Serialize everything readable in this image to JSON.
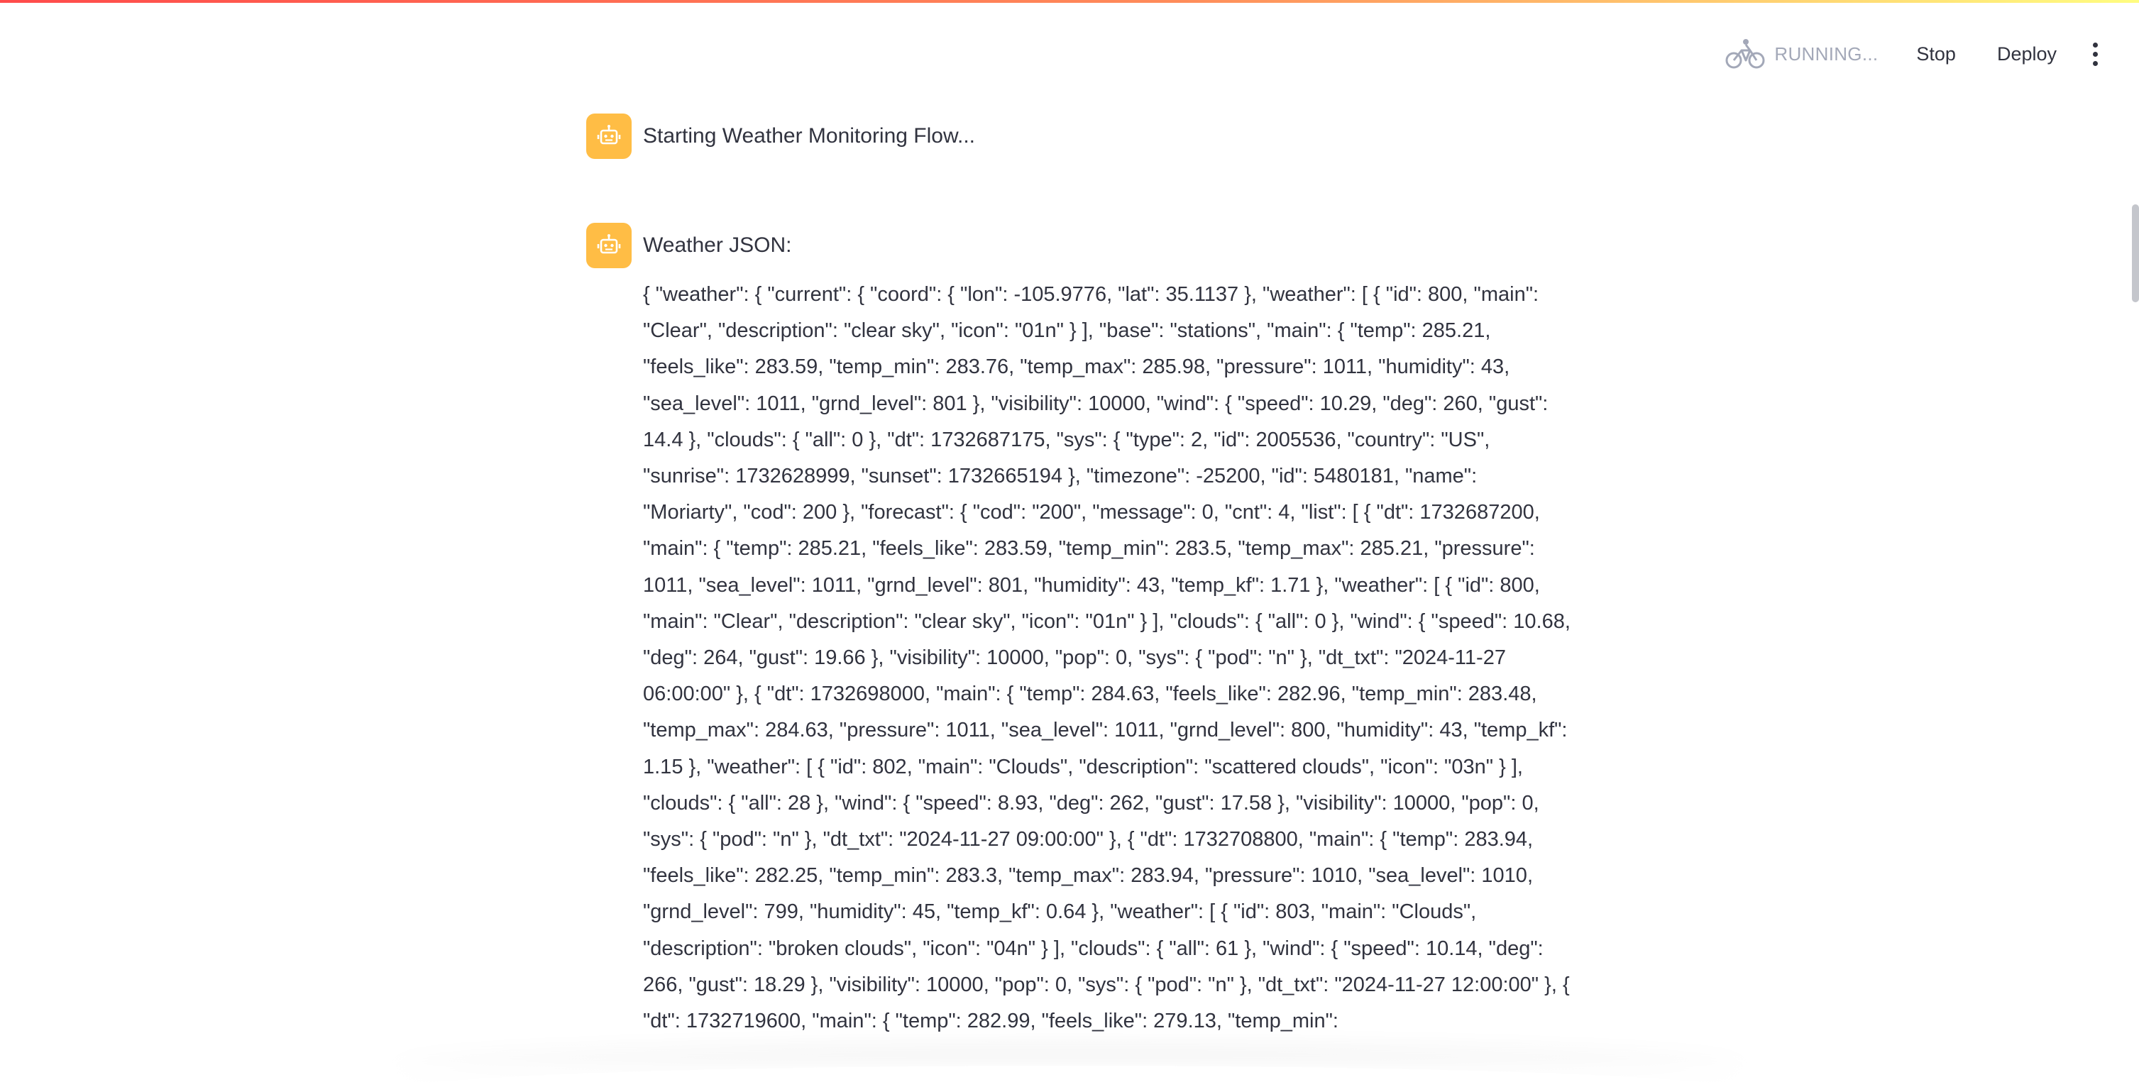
{
  "toolbar": {
    "status_label": "RUNNING...",
    "stop_label": "Stop",
    "deploy_label": "Deploy",
    "status_icon": "bicycle-icon",
    "menu_icon": "more-vertical-icon"
  },
  "messages": [
    {
      "avatar_icon": "robot-icon",
      "title": "Starting Weather Monitoring Flow..."
    },
    {
      "avatar_icon": "robot-icon",
      "title": "Weather JSON:",
      "body": "{ \"weather\": { \"current\": { \"coord\": { \"lon\": -105.9776, \"lat\": 35.1137 }, \"weather\": [ { \"id\": 800, \"main\": \"Clear\", \"description\": \"clear sky\", \"icon\": \"01n\" } ], \"base\": \"stations\", \"main\": { \"temp\": 285.21, \"feels_like\": 283.59, \"temp_min\": 283.76, \"temp_max\": 285.98, \"pressure\": 1011, \"humidity\": 43, \"sea_level\": 1011, \"grnd_level\": 801 }, \"visibility\": 10000, \"wind\": { \"speed\": 10.29, \"deg\": 260, \"gust\": 14.4 }, \"clouds\": { \"all\": 0 }, \"dt\": 1732687175, \"sys\": { \"type\": 2, \"id\": 2005536, \"country\": \"US\", \"sunrise\": 1732628999, \"sunset\": 1732665194 }, \"timezone\": -25200, \"id\": 5480181, \"name\": \"Moriarty\", \"cod\": 200 }, \"forecast\": { \"cod\": \"200\", \"message\": 0, \"cnt\": 4, \"list\": [ { \"dt\": 1732687200, \"main\": { \"temp\": 285.21, \"feels_like\": 283.59, \"temp_min\": 283.5, \"temp_max\": 285.21, \"pressure\": 1011, \"sea_level\": 1011, \"grnd_level\": 801, \"humidity\": 43, \"temp_kf\": 1.71 }, \"weather\": [ { \"id\": 800, \"main\": \"Clear\", \"description\": \"clear sky\", \"icon\": \"01n\" } ], \"clouds\": { \"all\": 0 }, \"wind\": { \"speed\": 10.68, \"deg\": 264, \"gust\": 19.66 }, \"visibility\": 10000, \"pop\": 0, \"sys\": { \"pod\": \"n\" }, \"dt_txt\": \"2024-11-27 06:00:00\" }, { \"dt\": 1732698000, \"main\": { \"temp\": 284.63, \"feels_like\": 282.96, \"temp_min\": 283.48, \"temp_max\": 284.63, \"pressure\": 1011, \"sea_level\": 1011, \"grnd_level\": 800, \"humidity\": 43, \"temp_kf\": 1.15 }, \"weather\": [ { \"id\": 802, \"main\": \"Clouds\", \"description\": \"scattered clouds\", \"icon\": \"03n\" } ], \"clouds\": { \"all\": 28 }, \"wind\": { \"speed\": 8.93, \"deg\": 262, \"gust\": 17.58 }, \"visibility\": 10000, \"pop\": 0, \"sys\": { \"pod\": \"n\" }, \"dt_txt\": \"2024-11-27 09:00:00\" }, { \"dt\": 1732708800, \"main\": { \"temp\": 283.94, \"feels_like\": 282.25, \"temp_min\": 283.3, \"temp_max\": 283.94, \"pressure\": 1010, \"sea_level\": 1010, \"grnd_level\": 799, \"humidity\": 45, \"temp_kf\": 0.64 }, \"weather\": [ { \"id\": 803, \"main\": \"Clouds\", \"description\": \"broken clouds\", \"icon\": \"04n\" } ], \"clouds\": { \"all\": 61 }, \"wind\": { \"speed\": 10.14, \"deg\": 266, \"gust\": 18.29 }, \"visibility\": 10000, \"pop\": 0, \"sys\": { \"pod\": \"n\" }, \"dt_txt\": \"2024-11-27 12:00:00\" }, { \"dt\": 1732719600, \"main\": { \"temp\": 282.99, \"feels_like\": 279.13, \"temp_min\":"
    }
  ]
}
